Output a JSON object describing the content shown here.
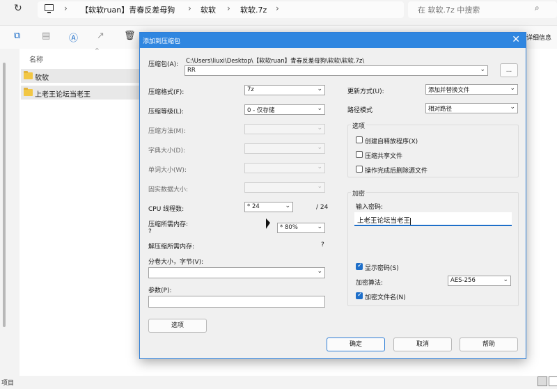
{
  "explorer": {
    "breadcrumbs": [
      "【软软ruan】青春反差母狗",
      "软软",
      "软软.7z"
    ],
    "search_placeholder": "在 软软.7z 中搜索",
    "details_label": "详细信息",
    "column_name": "名称",
    "files": [
      {
        "name": "软软",
        "icon": "folder-icon"
      },
      {
        "name": "上老王论坛当老王",
        "icon": "folder-icon"
      }
    ],
    "status_text": "项目"
  },
  "dialog": {
    "title": "添加到压缩包",
    "close_symbol": "✕",
    "archive_label": "压缩包(A):",
    "archive_path": "C:\\Users\\liuxi\\Desktop\\【软软ruan】青春反差母狗\\软软\\软软.7z\\",
    "archive_name": "RR",
    "browse_label": "...",
    "left": {
      "format_label": "压缩格式(F):",
      "format_value": "7z",
      "level_label": "压缩等级(L):",
      "level_value": "0 - 仅存储",
      "method_label": "压缩方法(M):",
      "dict_label": "字典大小(D):",
      "word_label": "单词大小(W):",
      "solid_label": "固实数据大小:",
      "cpu_label": "CPU 线程数:",
      "cpu_value": "* 24",
      "cpu_total": "/ 24",
      "mem_label": "压缩所需内存:",
      "mem_q": "?",
      "mem_value": "* 80%",
      "decomp_label": "解压缩所需内存:",
      "decomp_value": "?",
      "split_label": "分卷大小，字节(V):",
      "params_label": "参数(P):",
      "options_button": "选项"
    },
    "right": {
      "update_label": "更新方式(U):",
      "update_value": "添加并替换文件",
      "path_label": "路径模式",
      "path_value": "相对路径",
      "options_group": "选项",
      "opt_sfx": "创建自释放程序(X)",
      "opt_shared": "压缩共享文件",
      "opt_delete": "操作完成后删除源文件",
      "encrypt_group": "加密",
      "password_label": "输入密码:",
      "password_value": "上老王论坛当老王",
      "show_password": "显示密码(S)",
      "algo_label": "加密算法:",
      "algo_value": "AES-256",
      "encrypt_names": "加密文件名(N)"
    },
    "ok": "确定",
    "cancel": "取消",
    "help": "帮助"
  }
}
